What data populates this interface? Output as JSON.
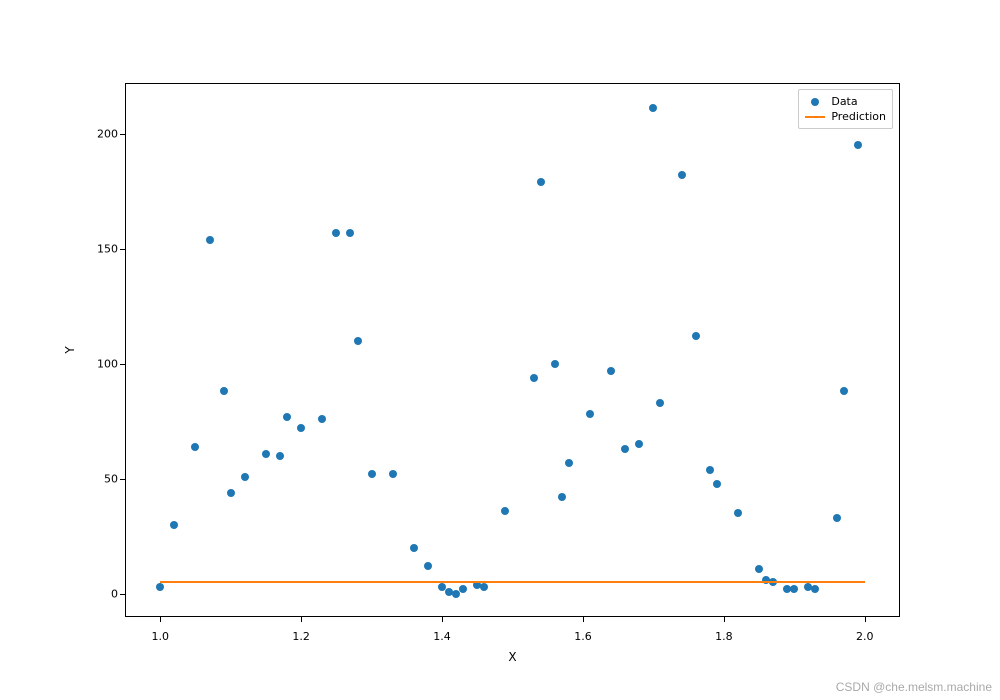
{
  "chart_data": {
    "type": "scatter+line",
    "xlabel": "X",
    "ylabel": "Y",
    "xlim": [
      0.95,
      2.05
    ],
    "ylim": [
      -10,
      222
    ],
    "xticks": [
      1.0,
      1.2,
      1.4,
      1.6,
      1.8,
      2.0
    ],
    "yticks": [
      0,
      50,
      100,
      150,
      200
    ],
    "series": [
      {
        "name": "Data",
        "type": "scatter",
        "color": "#1f77b4",
        "points": [
          {
            "x": 1.0,
            "y": 3
          },
          {
            "x": 1.02,
            "y": 30
          },
          {
            "x": 1.05,
            "y": 64
          },
          {
            "x": 1.07,
            "y": 154
          },
          {
            "x": 1.09,
            "y": 88
          },
          {
            "x": 1.1,
            "y": 44
          },
          {
            "x": 1.12,
            "y": 51
          },
          {
            "x": 1.15,
            "y": 61
          },
          {
            "x": 1.17,
            "y": 60
          },
          {
            "x": 1.18,
            "y": 77
          },
          {
            "x": 1.2,
            "y": 72
          },
          {
            "x": 1.23,
            "y": 76
          },
          {
            "x": 1.25,
            "y": 157
          },
          {
            "x": 1.27,
            "y": 157
          },
          {
            "x": 1.28,
            "y": 110
          },
          {
            "x": 1.3,
            "y": 52
          },
          {
            "x": 1.33,
            "y": 52
          },
          {
            "x": 1.36,
            "y": 20
          },
          {
            "x": 1.38,
            "y": 12
          },
          {
            "x": 1.4,
            "y": 3
          },
          {
            "x": 1.41,
            "y": 1
          },
          {
            "x": 1.42,
            "y": 0
          },
          {
            "x": 1.43,
            "y": 2
          },
          {
            "x": 1.45,
            "y": 4
          },
          {
            "x": 1.46,
            "y": 3
          },
          {
            "x": 1.49,
            "y": 36
          },
          {
            "x": 1.53,
            "y": 94
          },
          {
            "x": 1.54,
            "y": 179
          },
          {
            "x": 1.56,
            "y": 100
          },
          {
            "x": 1.57,
            "y": 42
          },
          {
            "x": 1.58,
            "y": 57
          },
          {
            "x": 1.61,
            "y": 78
          },
          {
            "x": 1.64,
            "y": 97
          },
          {
            "x": 1.66,
            "y": 63
          },
          {
            "x": 1.68,
            "y": 65
          },
          {
            "x": 1.7,
            "y": 211
          },
          {
            "x": 1.71,
            "y": 83
          },
          {
            "x": 1.74,
            "y": 182
          },
          {
            "x": 1.76,
            "y": 112
          },
          {
            "x": 1.78,
            "y": 54
          },
          {
            "x": 1.79,
            "y": 48
          },
          {
            "x": 1.82,
            "y": 35
          },
          {
            "x": 1.85,
            "y": 11
          },
          {
            "x": 1.86,
            "y": 6
          },
          {
            "x": 1.87,
            "y": 5
          },
          {
            "x": 1.89,
            "y": 2
          },
          {
            "x": 1.9,
            "y": 2
          },
          {
            "x": 1.92,
            "y": 3
          },
          {
            "x": 1.93,
            "y": 2
          },
          {
            "x": 1.96,
            "y": 33
          },
          {
            "x": 1.97,
            "y": 88
          },
          {
            "x": 1.99,
            "y": 195
          }
        ]
      },
      {
        "name": "Prediction",
        "type": "line",
        "color": "#ff7f0e",
        "x": [
          1.0,
          2.0
        ],
        "y": [
          5,
          5
        ]
      }
    ],
    "legend": {
      "position": "upper right",
      "entries": [
        "Data",
        "Prediction"
      ]
    }
  },
  "watermark": "CSDN @che.melsm.machine"
}
